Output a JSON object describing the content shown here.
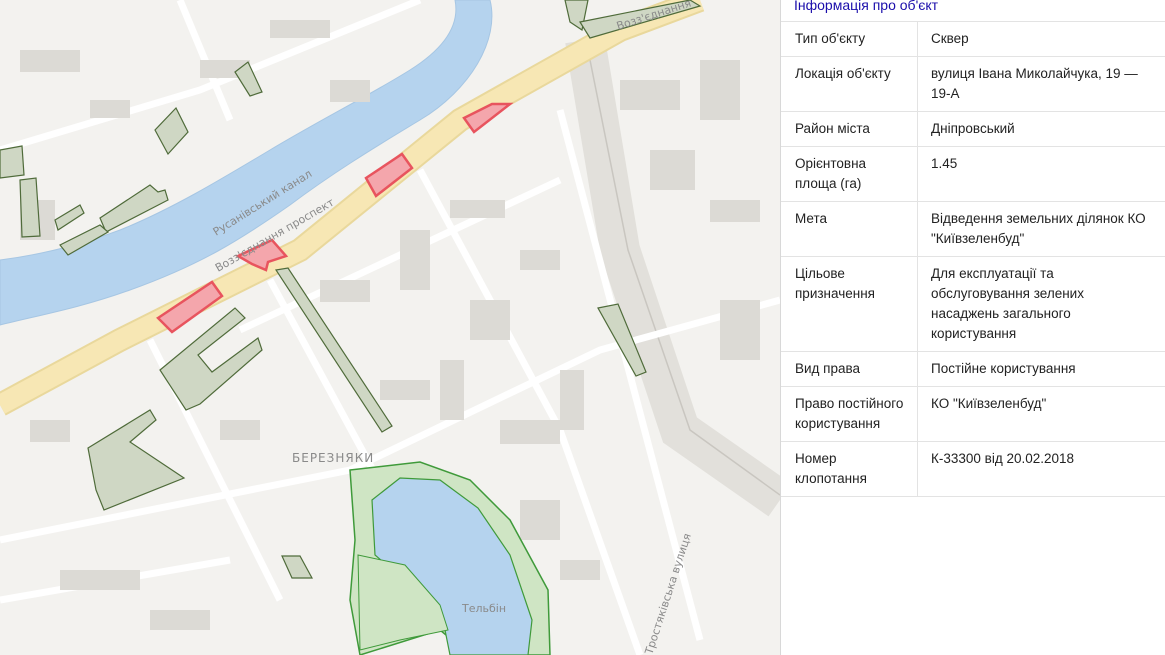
{
  "map": {
    "labels": {
      "canal": "Русанівський канал",
      "prospekt": "Возз'єднання проспект",
      "prospekt_top": "Возз'єднання",
      "district": "БЕРЕЗНЯКИ",
      "lake": "Тельбін",
      "street": "Тростяківська вулиця"
    },
    "colors": {
      "background": "#f3f2ef",
      "water": "#b5d3ee",
      "road_major": "#f7e7b4",
      "green_area": "#cfd7c4",
      "green_outline": "#4f6b3a",
      "park_fill": "#cfe5c4",
      "park_outline": "#3f9a3a",
      "selected_fill": "#f4a6ac",
      "selected_outline": "#e8545e",
      "building": "#dcdad5"
    }
  },
  "panel": {
    "title": "Інформація про об'єкт",
    "rows": [
      {
        "key": "Тип об'єкту",
        "value": "Сквер"
      },
      {
        "key": "Локація об'єкту",
        "value": "вулиця Івана Миколайчука, 19 — 19-А"
      },
      {
        "key": "Район міста",
        "value": "Дніпровський"
      },
      {
        "key": "Орієнтовна площа (га)",
        "value": "1.45"
      },
      {
        "key": "Мета",
        "value": "Відведення земельних ділянок КО \"Київзеленбуд\""
      },
      {
        "key": "Цільове призначення",
        "value": "Для експлуатації та обслуговування зелених насаджень загального користування"
      },
      {
        "key": "Вид права",
        "value": "Постійне користування"
      },
      {
        "key": "Право постійного користування",
        "value": "КО \"Київзеленбуд\""
      },
      {
        "key": "Номер клопотання",
        "value": "К-33300 від 20.02.2018"
      }
    ]
  }
}
